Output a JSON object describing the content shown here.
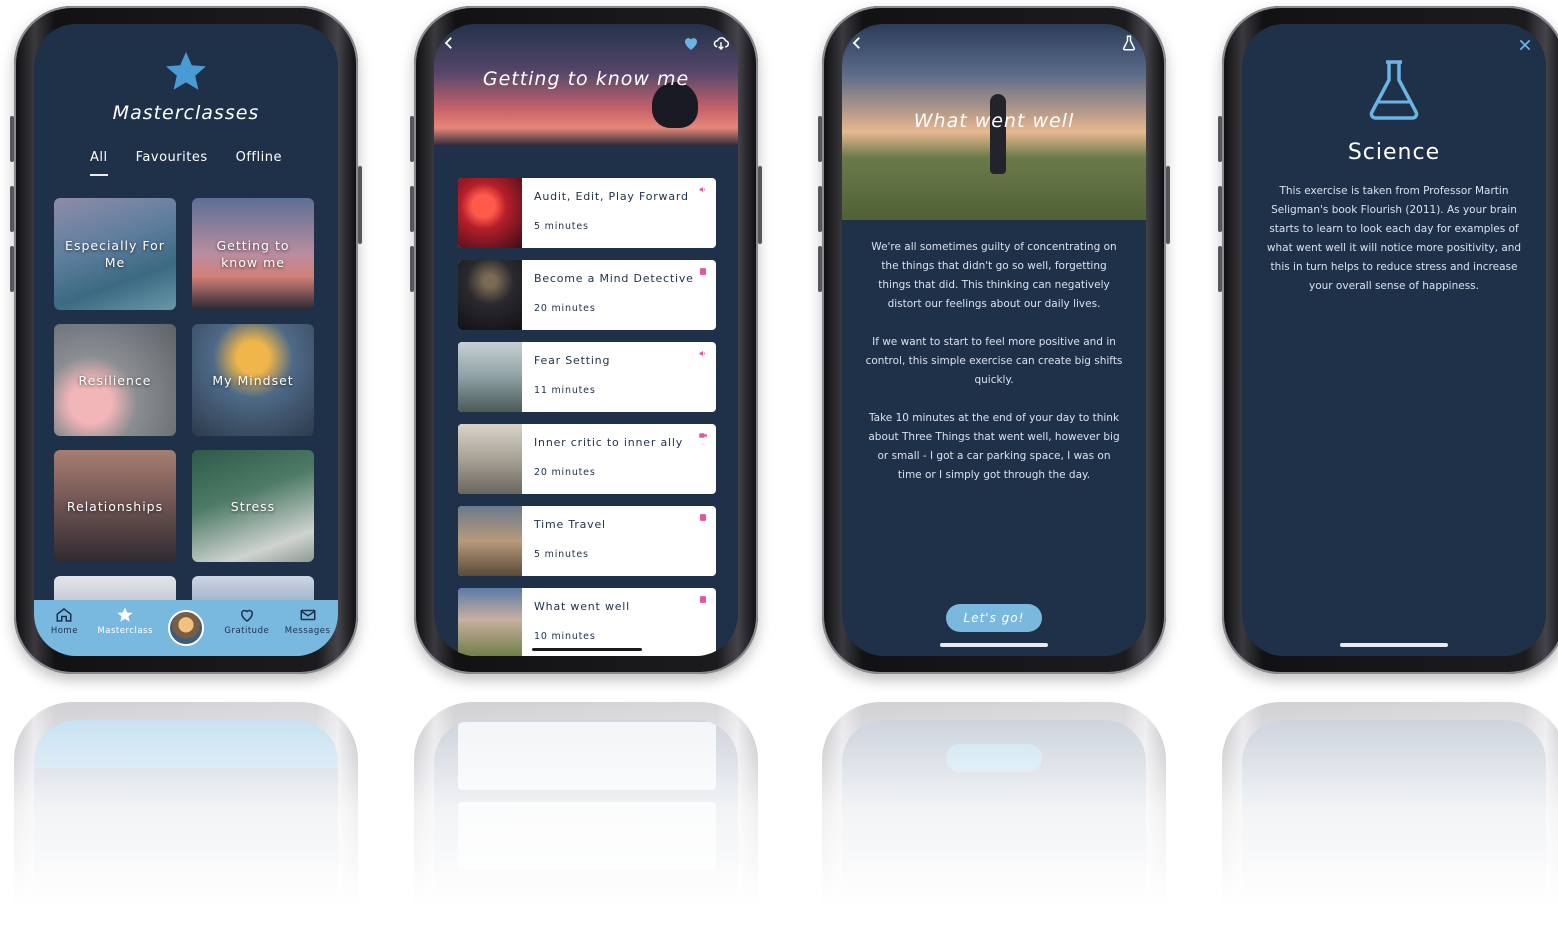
{
  "colors": {
    "screen_bg": "#1f3049",
    "accent_blue": "#79b9e0",
    "star_blue": "#4a9ad4",
    "badge_pink": "#e2579a",
    "card_bg": "#ffffff"
  },
  "phone1": {
    "title": "Masterclasses",
    "tabs": [
      {
        "label": "All",
        "active": true
      },
      {
        "label": "Favourites",
        "active": false
      },
      {
        "label": "Offline",
        "active": false
      }
    ],
    "tiles": [
      {
        "label": "Especially For Me"
      },
      {
        "label": "Getting to know me"
      },
      {
        "label": "Resilience"
      },
      {
        "label": "My Mindset"
      },
      {
        "label": "Relationships"
      },
      {
        "label": "Stress"
      }
    ],
    "nav": [
      {
        "label": "Home",
        "icon": "home-icon"
      },
      {
        "label": "Masterclass",
        "icon": "star-icon",
        "active": true
      },
      {
        "label": "",
        "icon": "avatar"
      },
      {
        "label": "Gratitude",
        "icon": "heart-icon"
      },
      {
        "label": "Messages",
        "icon": "mail-icon"
      }
    ]
  },
  "phone2": {
    "title": "Getting to know me",
    "items": [
      {
        "title": "Audit, Edit, Play Forward",
        "duration": "5 minutes",
        "badge": "audio-icon"
      },
      {
        "title": "Become a Mind Detective",
        "duration": "20 minutes",
        "badge": "book-icon"
      },
      {
        "title": "Fear Setting",
        "duration": "11 minutes",
        "badge": "audio-icon"
      },
      {
        "title": "Inner critic to inner ally",
        "duration": "20 minutes",
        "badge": "video-icon"
      },
      {
        "title": "Time Travel",
        "duration": "5 minutes",
        "badge": "book-icon"
      },
      {
        "title": "What went well",
        "duration": "10 minutes",
        "badge": "book-icon"
      }
    ]
  },
  "phone3": {
    "title": "What went well",
    "paragraphs": [
      "We're all sometimes guilty of concentrating on the things that didn't go so well, forgetting things that did. This thinking can negatively distort our feelings about our daily lives.",
      "If we want to start to feel more positive and in control, this simple exercise can create big shifts quickly.",
      "Take 10 minutes at the end of your day to think about Three Things that went well, however big or small - I got a car parking space, I was on time or I simply got through the day."
    ],
    "button": "Let's go!"
  },
  "phone4": {
    "title": "Science",
    "body": "This exercise is taken from Professor Martin Seligman's book Flourish (2011). As your brain starts to learn to look each day for examples of what went well it will notice more positivity, and this in turn helps to reduce stress and increase your overall sense of happiness."
  }
}
